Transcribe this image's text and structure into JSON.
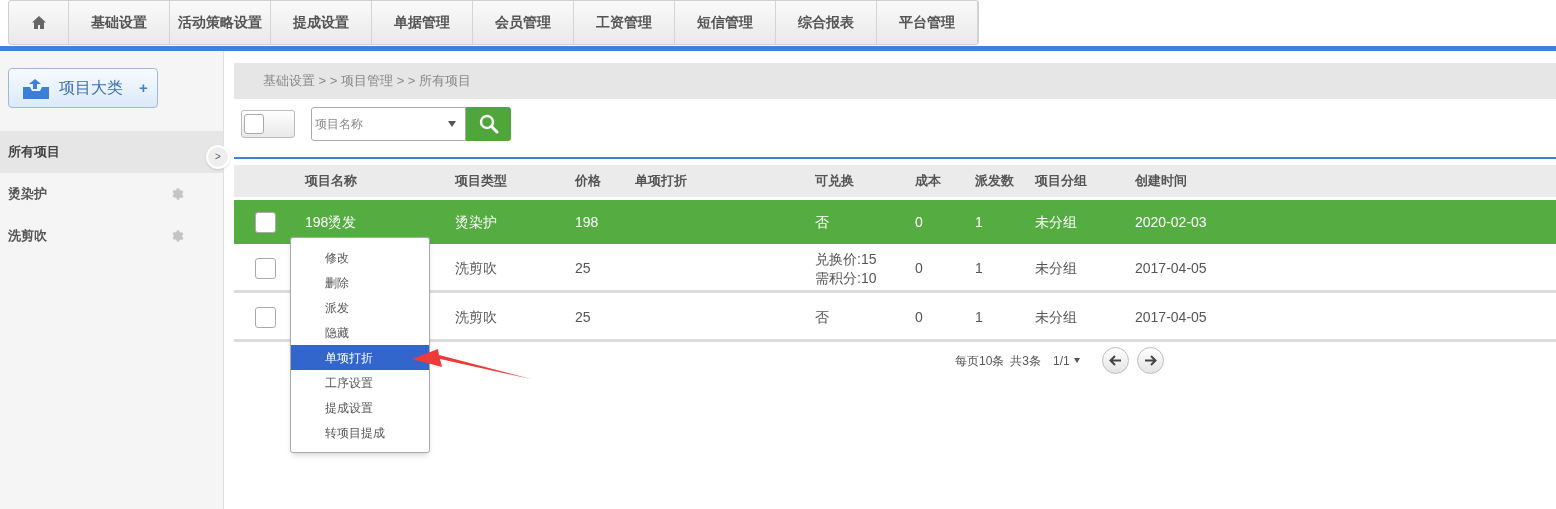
{
  "nav": {
    "tabs": [
      {
        "label": "基础设置"
      },
      {
        "label": "活动策略设置"
      },
      {
        "label": "提成设置"
      },
      {
        "label": "单据管理"
      },
      {
        "label": "会员管理"
      },
      {
        "label": "工资管理"
      },
      {
        "label": "短信管理"
      },
      {
        "label": "综合报表"
      },
      {
        "label": "平台管理"
      }
    ]
  },
  "sidebar": {
    "add_button": {
      "label": "项目大类",
      "plus": "+"
    },
    "collapse_glyph": ">",
    "items": [
      {
        "label": "所有项目",
        "selected": true,
        "kind": "all"
      },
      {
        "label": "烫染护",
        "selected": false,
        "kind": "category"
      },
      {
        "label": "洗剪吹",
        "selected": false,
        "kind": "category"
      }
    ]
  },
  "breadcrumb": "基础设置 > > 项目管理 > > 所有项目",
  "toolbar": {
    "toggle_checked": false,
    "select_placeholder": "项目名称"
  },
  "table": {
    "columns": [
      "项目名称",
      "项目类型",
      "价格",
      "单项打折",
      "可兑换",
      "成本",
      "派发数",
      "项目分组",
      "创建时间"
    ],
    "rows": [
      {
        "selected": true,
        "checked": false,
        "name": "198烫发",
        "type": "烫染护",
        "price": "198",
        "exchange": [
          "否"
        ],
        "cost": "0",
        "dispatch": "1",
        "group": "未分组",
        "created": "2020-02-03"
      },
      {
        "selected": false,
        "checked": false,
        "type": "洗剪吹",
        "price": "25",
        "exchange": [
          "兑换价:15",
          "需积分:10"
        ],
        "cost": "0",
        "dispatch": "1",
        "group": "未分组",
        "created": "2017-04-05"
      },
      {
        "selected": false,
        "checked": false,
        "type": "洗剪吹",
        "price": "25",
        "exchange": [
          "否"
        ],
        "cost": "0",
        "dispatch": "1",
        "group": "未分组",
        "created": "2017-04-05"
      }
    ]
  },
  "pagination": {
    "per_page": "每页10条",
    "total": "共3条",
    "page": "1/1"
  },
  "context_menu": [
    {
      "label": "修改",
      "selected": false
    },
    {
      "label": "删除",
      "selected": false
    },
    {
      "label": "派发",
      "selected": false
    },
    {
      "label": "隐藏",
      "selected": false
    },
    {
      "label": "单项打折",
      "selected": true
    },
    {
      "label": "工序设置",
      "selected": false
    },
    {
      "label": "提成设置",
      "selected": false
    },
    {
      "label": "转项目提成",
      "selected": false
    }
  ]
}
